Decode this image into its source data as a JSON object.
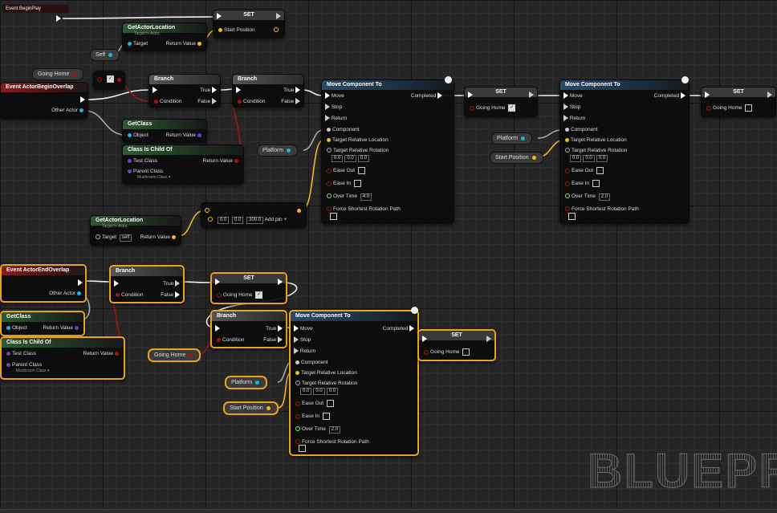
{
  "window": {
    "watermark": "BLUEPRINT"
  },
  "events": {
    "begin_play": "Event BeginPlay",
    "begin_overlap": "Event ActorBeginOverlap",
    "end_overlap": "Event ActorEndOverlap",
    "other_actor": "Other Actor"
  },
  "nodes": {
    "set_label": "SET",
    "start_position": "Start Position",
    "get_actor_location": "GetActorLocation",
    "target_is_actor": "Target is Actor",
    "target": "Target",
    "return_value": "Return Value",
    "self": "Self",
    "self_value": "self",
    "going_home": "Going Home",
    "branch": "Branch",
    "true_label": "True",
    "false_label": "False",
    "condition": "Condition",
    "get_class": "GetClass",
    "object": "Object",
    "class_is_child_of": "Class Is Child Of",
    "test_class": "Test Class",
    "parent_class": "Parent Class",
    "parent_class_value": "Mushroom Class",
    "platform": "Platform",
    "make_vector_x": "0.0",
    "make_vector_y": "0.0",
    "make_vector_z": "300.0",
    "add_pin": "Add pin",
    "move_component_to": "Move Component To",
    "move": "Move",
    "stop": "Stop",
    "return": "Return",
    "completed": "Completed",
    "component": "Component",
    "target_relative_location": "Target Relative Location",
    "target_relative_rotation": "Target Relative Rotation",
    "rot_x": "0.0",
    "rot_y": "0.0",
    "rot_z": "0.0",
    "ease_out": "Ease Out",
    "ease_in": "Ease In",
    "over_time": "Over Time",
    "force_shortest": "Force Shortest Rotation Path"
  },
  "move_nodes": [
    {
      "over_time": "4.0"
    },
    {
      "over_time": "2.0"
    },
    {
      "over_time": "2.0"
    }
  ],
  "colors": {
    "exec_wire": "#f0f0f0",
    "object_wire": "#1bb5e0",
    "vector_wire": "#f5b81c",
    "bool_wire": "#a01414",
    "selection": "#e8a318"
  }
}
